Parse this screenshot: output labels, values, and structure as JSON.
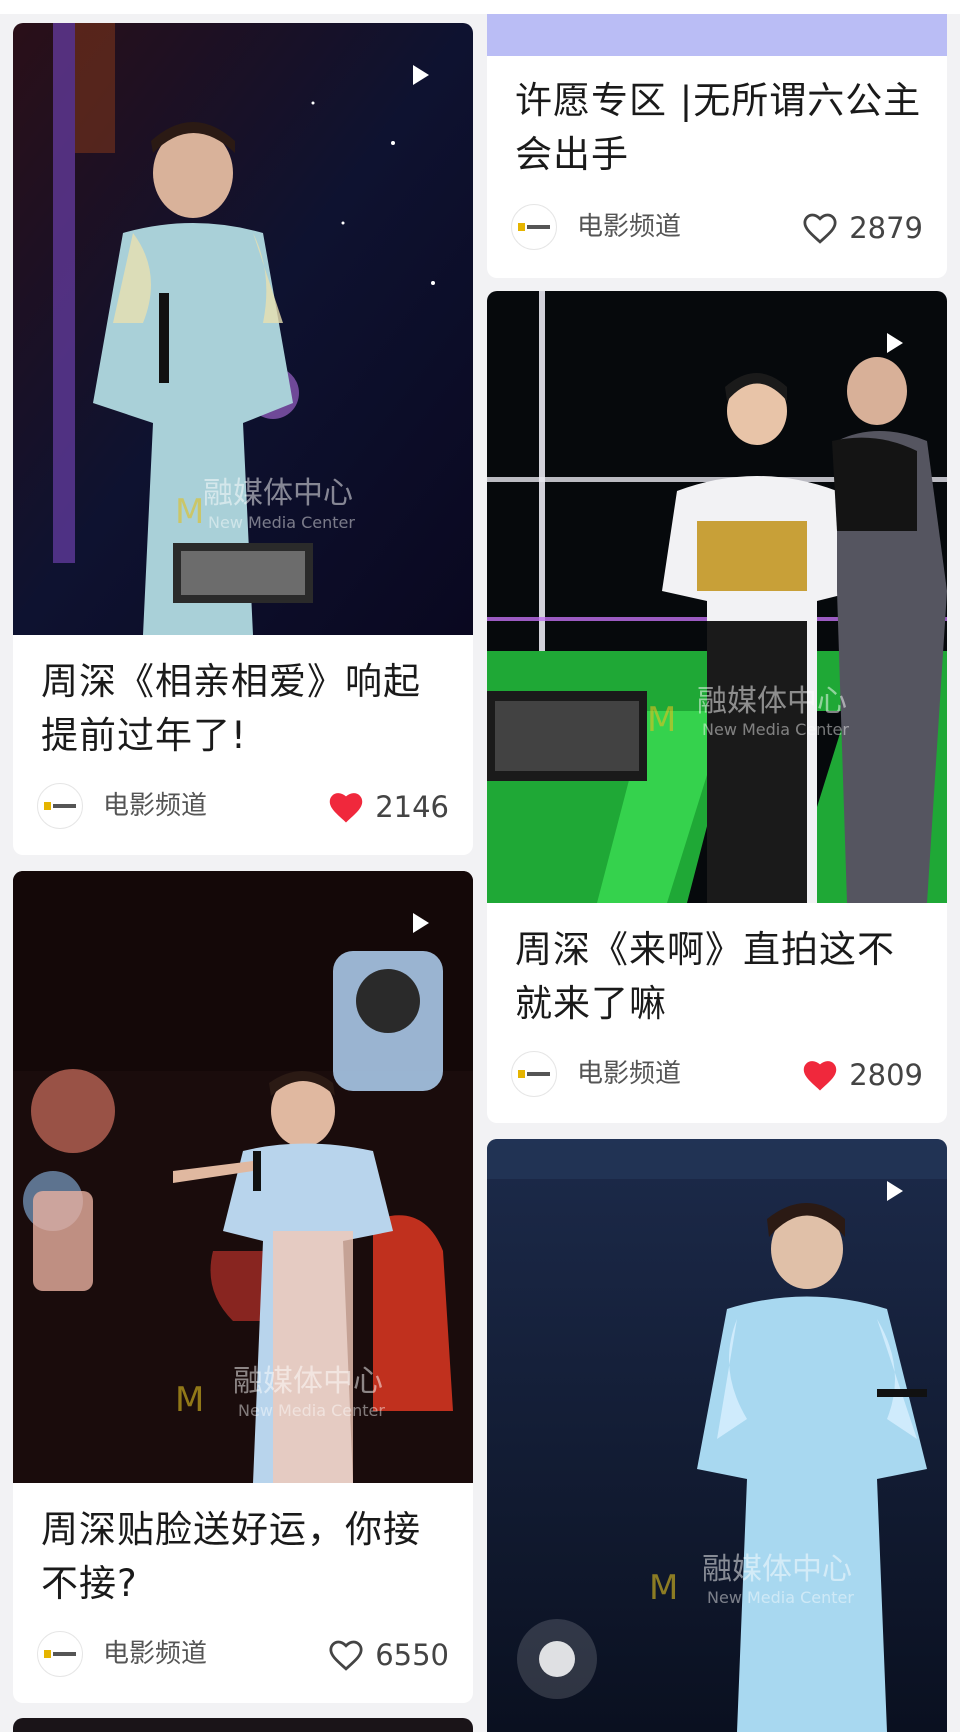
{
  "colors": {
    "page_bg": "#f2f2f4",
    "like_red": "#f0283c",
    "header_strip": "#babdf5"
  },
  "feed": {
    "left": [
      {
        "title": "周深《相亲相爱》响起提前过年了!",
        "author": "电影频道",
        "likes": "2146",
        "liked": true,
        "thumbnail_icon": "play-icon",
        "watermark": "融媒体中心 New Media Center"
      },
      {
        "title": "周深贴脸送好运，你接不接?",
        "author": "电影频道",
        "likes": "6550",
        "liked": false,
        "thumbnail_icon": "play-icon",
        "watermark": "融媒体中心 New Media Center"
      }
    ],
    "right": [
      {
        "title": "许愿专区 |无所谓六公主会出手",
        "author": "电影频道",
        "likes": "2879",
        "liked": false
      },
      {
        "title": "周深《来啊》直拍这不就来了嘛",
        "author": "电影频道",
        "likes": "2809",
        "liked": true,
        "thumbnail_icon": "play-icon",
        "watermark": "融媒体中心 New Media Center"
      },
      {
        "thumbnail_icon": "play-icon",
        "watermark": "融媒体中心 New Media Center"
      }
    ]
  }
}
